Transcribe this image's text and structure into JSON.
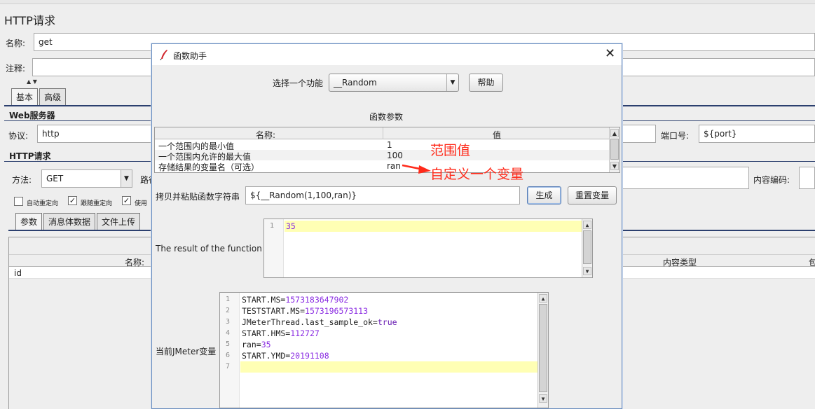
{
  "main": {
    "title": "HTTP请求",
    "name_label": "名称:",
    "name_value": "get",
    "comment_label": "注释:",
    "tabs": [
      "基本",
      "高级"
    ],
    "web_server_header": "Web服务器",
    "protocol_label": "协议:",
    "protocol_value": "http",
    "port_label": "端口号:",
    "port_value": "${port}",
    "http_request_header": "HTTP请求",
    "method_label": "方法:",
    "method_value": "GET",
    "path_label_partial": "路径",
    "content_encoding_label": "内容编码:",
    "checkboxes": [
      {
        "label": "自动重定向",
        "checked": false
      },
      {
        "label": "跟随重定向",
        "checked": true
      },
      {
        "label": "使用",
        "checked": true
      }
    ],
    "sub_tabs": [
      "参数",
      "消息体数据",
      "文件上传"
    ],
    "table_headers": [
      "名称:",
      "内容类型",
      "包"
    ],
    "table_rows": [
      {
        "name": "id"
      }
    ]
  },
  "dialog": {
    "title": "函数助手",
    "close_icon": "close-icon",
    "choose_function_label": "选择一个功能",
    "selected_function": "__Random",
    "help_button": "帮助",
    "params_title": "函数参数",
    "params_headers": [
      "名称:",
      "值"
    ],
    "params": [
      {
        "name": "一个范围内的最小值",
        "value": "1"
      },
      {
        "name": "一个范围内允许的最大值",
        "value": "100"
      },
      {
        "name": "存储结果的变量名（可选）",
        "value": "ran"
      }
    ],
    "copy_label": "拷贝并粘贴函数字符串",
    "function_string": "${__Random(1,100,ran)}",
    "generate_button": "生成",
    "reset_button": "重置变量",
    "result_label": "The result of the function is",
    "result_lines": [
      "35"
    ],
    "vars_label": "当前JMeter变量",
    "var_lines": [
      {
        "key": "START.MS",
        "val": "1573183647902"
      },
      {
        "key": "TESTSTART.MS",
        "val": "1573196573113"
      },
      {
        "key": "JMeterThread.last_sample_ok",
        "val": "true"
      },
      {
        "key": "START.HMS",
        "val": "112727"
      },
      {
        "key": "ran",
        "val": "35"
      },
      {
        "key": "START.YMD",
        "val": "20191108"
      },
      {
        "key": "",
        "val": ""
      }
    ]
  },
  "annotations": {
    "range_note": "范围值",
    "var_note": "自定义一个变量",
    "color": "#ff2a1a"
  },
  "colors": {
    "highlight_line": "#ffffb4",
    "header_rule": "#2b3f6e",
    "number_purple": "#8a2be2"
  }
}
